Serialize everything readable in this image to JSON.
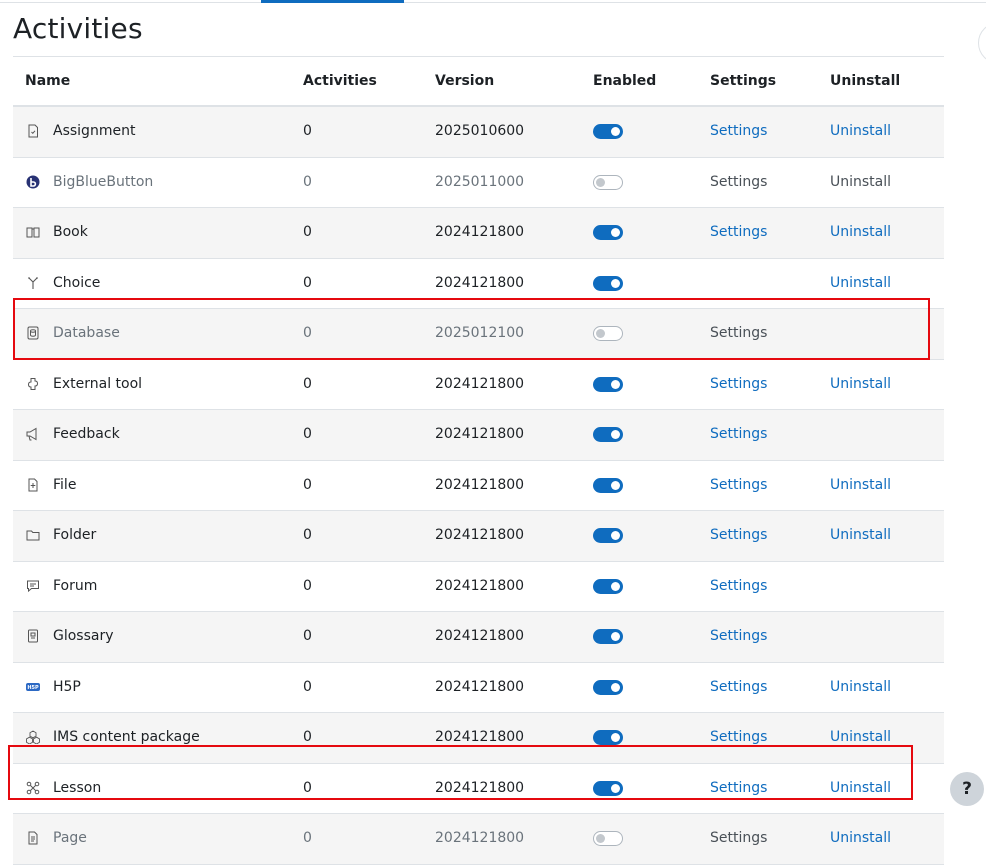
{
  "page": {
    "title": "Activities"
  },
  "columns": {
    "name": "Name",
    "activities": "Activities",
    "version": "Version",
    "enabled": "Enabled",
    "settings": "Settings",
    "uninstall": "Uninstall"
  },
  "colors": {
    "accent": "#0f6cbf",
    "highlight": "#e5090f"
  },
  "help": {
    "label": "?"
  },
  "rows": [
    {
      "icon": "assignment-icon",
      "name": "Assignment",
      "activities": "0",
      "version": "2025010600",
      "enabled": true,
      "settings": "Settings",
      "settings_link": true,
      "uninstall": "Uninstall",
      "uninstall_link": true
    },
    {
      "icon": "bigbluebutton-icon",
      "name": "BigBlueButton",
      "activities": "0",
      "version": "2025011000",
      "enabled": false,
      "settings": "Settings",
      "settings_link": false,
      "uninstall": "Uninstall",
      "uninstall_link": false
    },
    {
      "icon": "book-icon",
      "name": "Book",
      "activities": "0",
      "version": "2024121800",
      "enabled": true,
      "settings": "Settings",
      "settings_link": true,
      "uninstall": "Uninstall",
      "uninstall_link": true
    },
    {
      "icon": "choice-icon",
      "name": "Choice",
      "activities": "0",
      "version": "2024121800",
      "enabled": true,
      "settings": "",
      "settings_link": false,
      "uninstall": "Uninstall",
      "uninstall_link": true
    },
    {
      "icon": "database-icon",
      "name": "Database",
      "activities": "0",
      "version": "2025012100",
      "enabled": false,
      "settings": "Settings",
      "settings_link": false,
      "uninstall": "",
      "uninstall_link": false
    },
    {
      "icon": "external-tool-icon",
      "name": "External tool",
      "activities": "0",
      "version": "2024121800",
      "enabled": true,
      "settings": "Settings",
      "settings_link": true,
      "uninstall": "Uninstall",
      "uninstall_link": true
    },
    {
      "icon": "feedback-icon",
      "name": "Feedback",
      "activities": "0",
      "version": "2024121800",
      "enabled": true,
      "settings": "Settings",
      "settings_link": true,
      "uninstall": "",
      "uninstall_link": false
    },
    {
      "icon": "file-icon",
      "name": "File",
      "activities": "0",
      "version": "2024121800",
      "enabled": true,
      "settings": "Settings",
      "settings_link": true,
      "uninstall": "Uninstall",
      "uninstall_link": true
    },
    {
      "icon": "folder-icon",
      "name": "Folder",
      "activities": "0",
      "version": "2024121800",
      "enabled": true,
      "settings": "Settings",
      "settings_link": true,
      "uninstall": "Uninstall",
      "uninstall_link": true
    },
    {
      "icon": "forum-icon",
      "name": "Forum",
      "activities": "0",
      "version": "2024121800",
      "enabled": true,
      "settings": "Settings",
      "settings_link": true,
      "uninstall": "",
      "uninstall_link": false
    },
    {
      "icon": "glossary-icon",
      "name": "Glossary",
      "activities": "0",
      "version": "2024121800",
      "enabled": true,
      "settings": "Settings",
      "settings_link": true,
      "uninstall": "",
      "uninstall_link": false
    },
    {
      "icon": "h5p-icon",
      "name": "H5P",
      "activities": "0",
      "version": "2024121800",
      "enabled": true,
      "settings": "Settings",
      "settings_link": true,
      "uninstall": "Uninstall",
      "uninstall_link": true
    },
    {
      "icon": "ims-package-icon",
      "name": "IMS content package",
      "activities": "0",
      "version": "2024121800",
      "enabled": true,
      "settings": "Settings",
      "settings_link": true,
      "uninstall": "Uninstall",
      "uninstall_link": true
    },
    {
      "icon": "lesson-icon",
      "name": "Lesson",
      "activities": "0",
      "version": "2024121800",
      "enabled": true,
      "settings": "Settings",
      "settings_link": true,
      "uninstall": "Uninstall",
      "uninstall_link": true
    },
    {
      "icon": "page-icon",
      "name": "Page",
      "activities": "0",
      "version": "2024121800",
      "enabled": false,
      "settings": "Settings",
      "settings_link": false,
      "uninstall": "Uninstall",
      "uninstall_link": true
    }
  ]
}
